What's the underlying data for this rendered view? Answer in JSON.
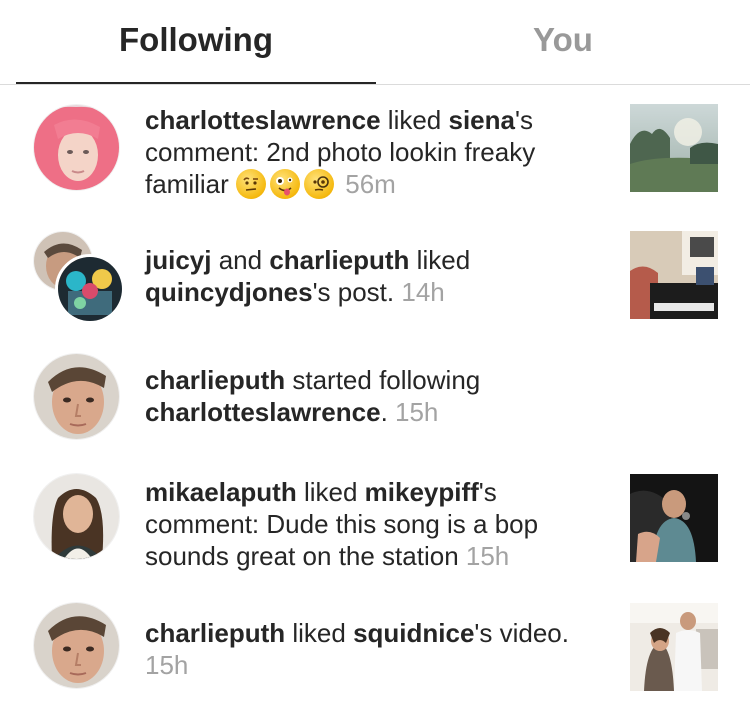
{
  "tabs": {
    "following": "Following",
    "you": "You"
  },
  "notifications": [
    {
      "user": "charlotteslawrence",
      "text1": " liked ",
      "target": "siena",
      "text2": "'s comment: 2nd photo lookin freaky familiar ",
      "emojis": [
        "face-with-raised-eyebrow-emoji",
        "zany-face-emoji",
        "face-with-monocle-emoji"
      ],
      "time": "56m"
    },
    {
      "user": "juicyj",
      "and": " and ",
      "user2": "charlieputh",
      "text1": " liked ",
      "target": "quincydjones",
      "text2": "'s post. ",
      "time": "14h"
    },
    {
      "user": "charlieputh",
      "text1": " started following ",
      "target": "charlotteslawrence",
      "text2": ". ",
      "time": "15h"
    },
    {
      "user": "mikaelaputh",
      "text1": " liked ",
      "target": "mikeypiff",
      "text2": "'s comment: Dude this song is a bop sounds great on the station ",
      "time": "15h"
    },
    {
      "user": "charlieputh",
      "text1": " liked ",
      "target": "squidnice",
      "text2": "'s video. ",
      "time": "15h"
    }
  ]
}
